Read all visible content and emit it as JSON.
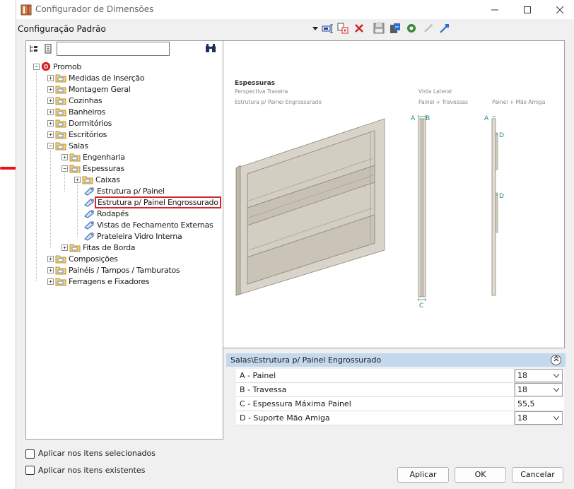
{
  "window": {
    "title": "Configurador de Dimensões",
    "configuration": "Configuração Padrão"
  },
  "tree": {
    "search_value": "",
    "root": "Promob",
    "items": [
      {
        "label": "Medidas de Inserção"
      },
      {
        "label": "Montagem Geral"
      },
      {
        "label": "Cozinhas"
      },
      {
        "label": "Banheiros"
      },
      {
        "label": "Dormitórios"
      },
      {
        "label": "Escritórios"
      },
      {
        "label": "Salas"
      },
      {
        "label": "Engenharia"
      },
      {
        "label": "Espessuras"
      },
      {
        "label": "Caixas"
      },
      {
        "label": "Estrutura p/ Painel"
      },
      {
        "label": "Estrutura p/ Painel Engrossurado"
      },
      {
        "label": "Rodapés"
      },
      {
        "label": "Vistas de Fechamento Externas"
      },
      {
        "label": "Prateleira Vidro Interna"
      },
      {
        "label": "Fitas de Borda"
      },
      {
        "label": "Composições"
      },
      {
        "label": "Painéis / Tampos / Tamburatos"
      },
      {
        "label": "Ferragens e Fixadores"
      }
    ]
  },
  "preview": {
    "heading": "Espessuras",
    "sub1": "Perspectiva Traseira",
    "sub2": "Estrutura p/ Painel Engrossurado",
    "side_view": "Vista Lateral",
    "col1": "Painel + Travessas",
    "col2": "Painel + Mão Amiga",
    "marks": {
      "a": "A",
      "b": "B",
      "c": "C",
      "d": "D"
    }
  },
  "properties": {
    "path": "Salas\\Estrutura p/ Painel Engrossurado",
    "rows": [
      {
        "name": "A - Painel",
        "value": "18"
      },
      {
        "name": "B - Travessa",
        "value": "18"
      },
      {
        "name": "C - Espessura Máxima Painel",
        "value": "55,5"
      },
      {
        "name": "D - Suporte Mão Amiga",
        "value": "18"
      }
    ]
  },
  "options": {
    "apply_selected": "Aplicar nos itens selecionados",
    "apply_existing": "Aplicar nos itens existentes"
  },
  "buttons": {
    "apply": "Aplicar",
    "ok": "OK",
    "cancel": "Cancelar"
  },
  "colors": {
    "highlight_border": "#d9262c",
    "header_bar": "#c4d8ee",
    "arrow": "#e8141b"
  }
}
